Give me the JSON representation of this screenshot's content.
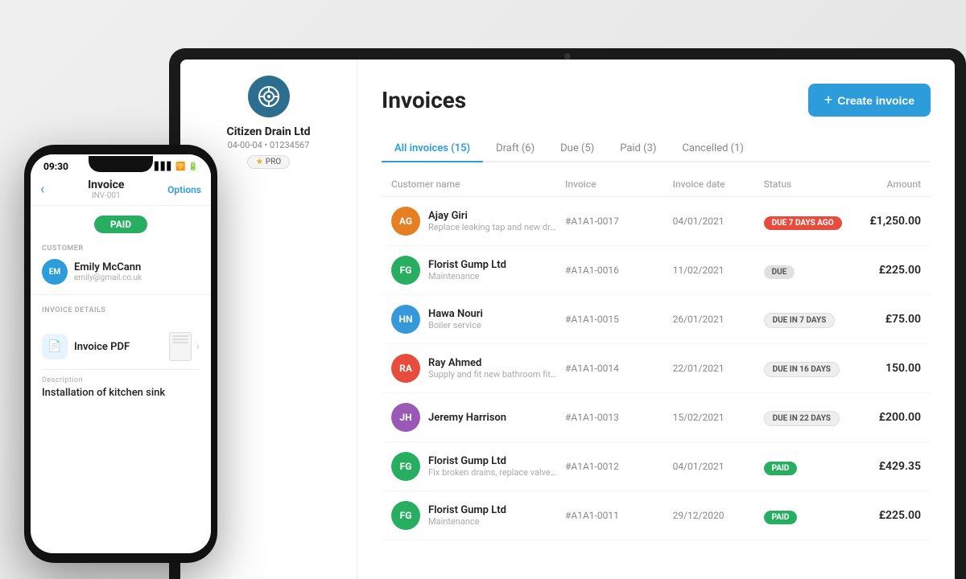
{
  "background": {
    "color": "#e8e8e8"
  },
  "tablet": {
    "company": {
      "name": "Citizen Drain Ltd",
      "id": "04-00-04 • 01234567",
      "badge": "PRO"
    },
    "page": {
      "title": "Invoices",
      "create_button": "Create invoice"
    },
    "tabs": [
      {
        "label": "All invoices (15)",
        "active": true
      },
      {
        "label": "Draft (6)",
        "active": false
      },
      {
        "label": "Due (5)",
        "active": false
      },
      {
        "label": "Paid (3)",
        "active": false
      },
      {
        "label": "Cancelled (1)",
        "active": false
      }
    ],
    "table": {
      "headers": [
        "Customer name",
        "Invoice",
        "Invoice date",
        "Status",
        "Amount"
      ],
      "rows": [
        {
          "initials": "AG",
          "avatar_color": "#e67e22",
          "name": "Ajay Giri",
          "desc": "Replace leaking tap and new drain",
          "invoice": "#A1A1-0017",
          "date": "04/01/2021",
          "status": "DUE 7 DAYS AGO",
          "status_type": "due-ago",
          "amount": "£1,250.00"
        },
        {
          "initials": "FG",
          "avatar_color": "#27ae60",
          "name": "Florist Gump Ltd",
          "desc": "Maintenance",
          "invoice": "#A1A1-0016",
          "date": "11/02/2021",
          "status": "DUE",
          "status_type": "due",
          "amount": "£225.00"
        },
        {
          "initials": "HN",
          "avatar_color": "#3498db",
          "name": "Hawa Nouri",
          "desc": "Boiler service",
          "invoice": "#A1A1-0015",
          "date": "26/01/2021",
          "status": "DUE IN 7 DAYS",
          "status_type": "due-7",
          "amount": "£75.00"
        },
        {
          "initials": "RA",
          "avatar_color": "#e74c3c",
          "name": "Ray Ahmed",
          "desc": "Supply and fit new bathroom fittings with...",
          "invoice": "#A1A1-0014",
          "date": "22/01/2021",
          "status": "DUE IN 16 DAYS",
          "status_type": "due-16",
          "amount": "150.00"
        },
        {
          "initials": "JH",
          "avatar_color": "#9b59b6",
          "name": "Jeremy Harrison",
          "desc": "",
          "invoice": "#A1A1-0013",
          "date": "15/02/2021",
          "status": "DUE IN 22 DAYS",
          "status_type": "due-22",
          "amount": "£200.00"
        },
        {
          "initials": "FG",
          "avatar_color": "#27ae60",
          "name": "Florist Gump Ltd",
          "desc": "Fix broken drains, replace valve and sup...",
          "invoice": "#A1A1-0012",
          "date": "04/01/2021",
          "status": "PAID",
          "status_type": "paid",
          "amount": "£429.35"
        },
        {
          "initials": "FG",
          "avatar_color": "#27ae60",
          "name": "Florist Gump Ltd",
          "desc": "Maintenance",
          "invoice": "#A1A1-0011",
          "date": "29/12/2020",
          "status": "PAID",
          "status_type": "paid",
          "amount": "£225.00"
        }
      ]
    }
  },
  "phone": {
    "time": "09:30",
    "header": {
      "title": "Invoice",
      "subtitle": "INV-001",
      "options": "Options"
    },
    "status": "PAID",
    "customer_section_label": "CUSTOMER",
    "customer": {
      "initials": "EM",
      "name": "Emily McCann",
      "email": "emily@gmail.co.uk"
    },
    "invoice_section_label": "INVOICE DETAILS",
    "invoice_pdf_label": "Invoice PDF",
    "description_label": "Description",
    "description": "Installation of kitchen sink"
  }
}
